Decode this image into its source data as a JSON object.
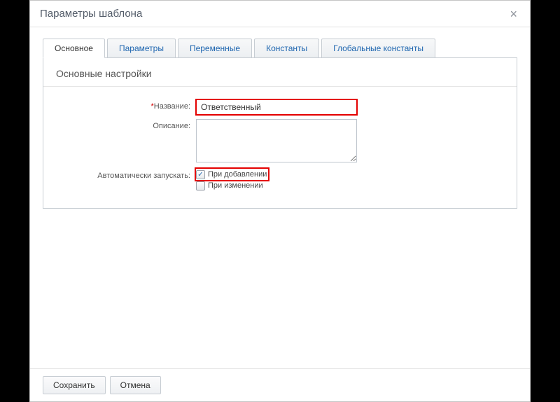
{
  "dialog": {
    "title": "Параметры шаблона",
    "close": "×"
  },
  "tabs": [
    {
      "label": "Основное",
      "active": true
    },
    {
      "label": "Параметры"
    },
    {
      "label": "Переменные"
    },
    {
      "label": "Константы"
    },
    {
      "label": "Глобальные константы"
    }
  ],
  "section": {
    "title": "Основные настройки"
  },
  "form": {
    "name_label": "Название:",
    "name_value": "Ответственный",
    "desc_label": "Описание:",
    "desc_value": "",
    "autorun_label": "Автоматически запускать:",
    "on_add_label": "При добавлении",
    "on_add_checked": true,
    "on_change_label": "При изменении",
    "on_change_checked": false
  },
  "footer": {
    "save": "Сохранить",
    "cancel": "Отмена"
  }
}
